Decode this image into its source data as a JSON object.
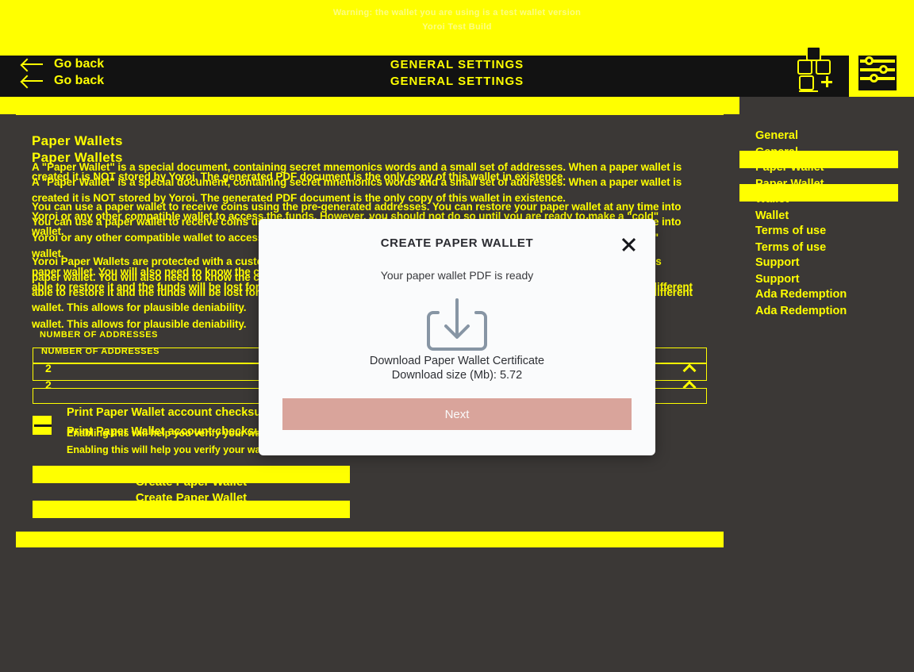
{
  "banner": {
    "line1": "Warning: the wallet you are using is a test wallet version",
    "line2": "Yoroi Test Build"
  },
  "navbar": {
    "back_label": "Go back",
    "title": "GENERAL SETTINGS",
    "apps_icon": "apps-grid-icon",
    "settings_icon": "sliders-settings-icon"
  },
  "main": {
    "heading": "Paper Wallets",
    "paragraphs": [
      "A \"Paper Wallet\" is a special document, containing secret mnemonics words and a small set of addresses. When a paper wallet is",
      "created it is NOT stored by Yoroi. The generated PDF document is the only copy of this wallet in existence.",
      "You can use a paper wallet to receive coins using the pre-generated addresses. You can restore your paper wallet at any time into",
      "Yoroi or any other compatible wallet to access the funds. However, you should not do so until you are ready to make a \"cold\"",
      "wallet.",
      "Yoroi Paper Wallets are protected with a custom password. Only the person who knows the password will have access to this",
      "paper wallet. You will also need to know the correct password for the paper wallet, otherwise nobody, not even you, will be",
      "able to restore it and the funds will be lost forever. You can also use your own password to protect your paper wallet with a different",
      "wallet. This allows for plausible deniability."
    ],
    "addresses_label": "NUMBER OF ADDRESSES",
    "addresses_value": "2",
    "checkbox_label": "Print Paper Wallet account checksum",
    "checkbox_sub": "Enabling this will help you verify your wallet",
    "create_button": "Create Paper Wallet"
  },
  "sidebar": {
    "items": [
      {
        "label": "General",
        "selected": false
      },
      {
        "label": "Paper Wallet",
        "selected": true
      },
      {
        "label": "Wallet",
        "selected": false
      },
      {
        "label": "Terms of use",
        "selected": false
      },
      {
        "label": "Support",
        "selected": false
      },
      {
        "label": "Ada Redemption",
        "selected": false
      }
    ]
  },
  "modal": {
    "title": "CREATE PAPER WALLET",
    "subtitle": "Your paper wallet PDF is ready",
    "download_icon": "download-tray-icon",
    "download_label": "Download Paper Wallet Certificate",
    "download_size": "Download size (Mb): 5.72",
    "next_label": "Next",
    "close_icon": "close-icon"
  },
  "colors": {
    "accent_yellow": "#ffff00",
    "page_background": "#3b3836",
    "navbar_background": "#121212",
    "modal_background": "#fafbfc",
    "next_button": "#d9a49b"
  }
}
